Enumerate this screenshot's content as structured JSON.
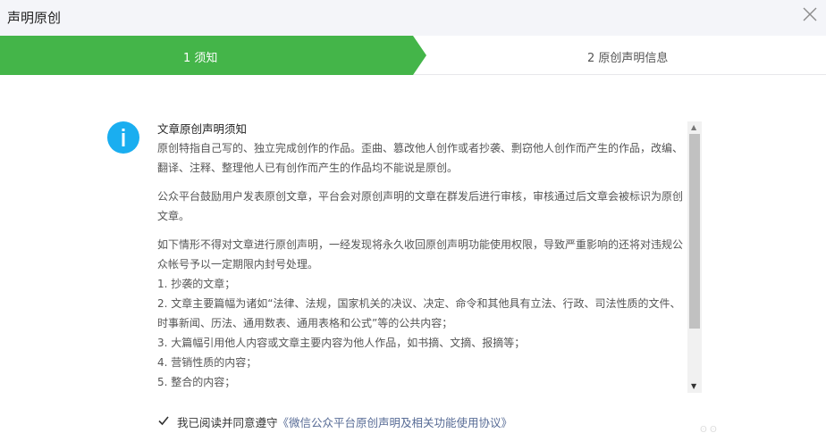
{
  "dialog": {
    "title": "声明原创",
    "close_icon": "close-icon"
  },
  "steps": [
    {
      "label": "1 须知",
      "state": "active"
    },
    {
      "label": "2 原创声明信息",
      "state": "inactive"
    }
  ],
  "colors": {
    "active_step": "#44b549",
    "info_icon": "#1aaef0",
    "link": "#576b95",
    "header_bg": "#f4f5f9"
  },
  "notice": {
    "icon": "info-icon",
    "heading": "文章原创声明须知",
    "paragraphs": [
      "原创特指自己写的、独立完成创作的作品。歪曲、篡改他人创作或者抄袭、剽窃他人创作而产生的作品，改编、翻译、注释、整理他人已有创作而产生的作品均不能说是原创。",
      "公众平台鼓励用户发表原创文章，平台会对原创声明的文章在群发后进行审核，审核通过后文章会被标识为原创文章。",
      "如下情形不得对文章进行原创声明，一经发现将永久收回原创声明功能使用权限，导致严重影响的还将对违规公众帐号予以一定期限内封号处理。"
    ],
    "list": [
      "1. 抄袭的文章；",
      "2. 文章主要篇幅为诸如“法律、法规，国家机关的决议、决定、命令和其他具有立法、行政、司法性质的文件、时事新闻、历法、通用数表、通用表格和公式”等的公共内容；",
      "3. 大篇幅引用他人内容或文章主要内容为他人作品，如书摘、文摘、报摘等；",
      "4. 营销性质的内容；",
      "5. 整合的内容；"
    ]
  },
  "agreement": {
    "checked": true,
    "text": "我已阅读并同意遵守",
    "link": "《微信公众平台原创声明及相关功能使用协议》"
  },
  "scrollbar": {
    "up_icon": "scroll-up-arrow-icon",
    "down_icon": "scroll-down-arrow-icon"
  }
}
